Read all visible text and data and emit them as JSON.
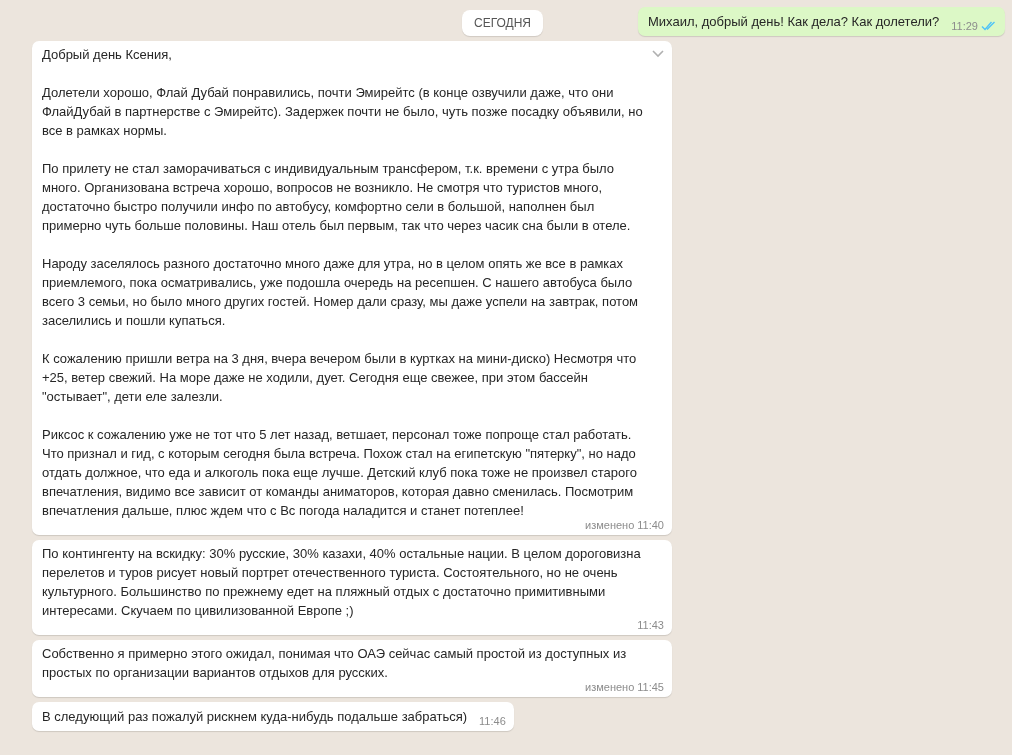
{
  "date_divider": "СЕГОДНЯ",
  "messages": [
    {
      "kind": "outgoing",
      "paragraphs": [
        "Михаил, добрый день! Как дела? Как долетели?"
      ],
      "time": "11:29",
      "read": true
    },
    {
      "kind": "incoming",
      "menu_caret": true,
      "paragraphs": [
        "Добрый день Ксения,",
        "Долетели хорошо, Флай Дубай понравились, почти Эмирейтс (в конце озвучили даже, что они ФлайДубай в партнерстве с Эмирейтс). Задержек почти не было, чуть позже посадку объявили, но все в рамках нормы.",
        "По прилету не стал заморачиваться с индивидуальным трансфером, т.к. времени с утра было много. Организована встреча хорошо, вопросов не возникло. Не смотря что туристов много, достаточно быстро получили инфо по автобусу, комфортно сели в большой, наполнен был примерно чуть больше половины. Наш отель был первым, так что через часик сна были в отеле.",
        "Народу заселялось разного достаточно много даже для утра, но в целом опять же все в рамках приемлемого, пока осматривались, уже подошла очередь на ресепшен. С нашего автобуса было всего 3 семьи, но было много других гостей. Номер дали сразу, мы даже успели на завтрак, потом заселились и пошли купаться.",
        "К сожалению пришли ветра на 3 дня, вчера вечером были в куртках на мини-диско) Несмотря что +25, ветер свежий. На море даже не ходили, дует. Сегодня еще свежее, при этом бассейн \"остывает\", дети еле залезли.",
        "Риксос к сожалению уже не тот что 5 лет назад, ветшает, персонал тоже попроще стал работать. Что признал и гид, с которым сегодня была встреча. Похож стал на египетскую \"пятерку\", но надо отдать должное, что еда и алкоголь пока еще лучше. Детский клуб пока тоже не произвел старого впечатления, видимо все зависит от команды аниматоров, которая давно сменилась. Посмотрим впечатления дальше, плюс ждем что с Вс погода наладится и станет потеплее!"
      ],
      "edited_label": "изменено",
      "time": "11:40"
    },
    {
      "kind": "incoming",
      "paragraphs": [
        "По контингенту на вскидку: 30% русские, 30% казахи, 40% остальные нации. В целом дороговизна перелетов и туров рисует новый портрет отечественного туриста. Состоятельного, но не очень культурного. Большинство по прежнему едет на пляжный отдых с достаточно примитивными интересами. Скучаем по цивилизованной Европе ;)"
      ],
      "time": "11:43"
    },
    {
      "kind": "incoming",
      "paragraphs": [
        "Собственно я примерно этого ожидал, понимая что ОАЭ сейчас самый простой из доступных из простых по организации вариантов отдыхов для русских."
      ],
      "edited_label": "изменено",
      "time": "11:45"
    },
    {
      "kind": "incoming",
      "paragraphs": [
        "В следующий раз пожалуй рискнем куда-нибудь подальше забраться)"
      ],
      "time": "11:46"
    }
  ]
}
